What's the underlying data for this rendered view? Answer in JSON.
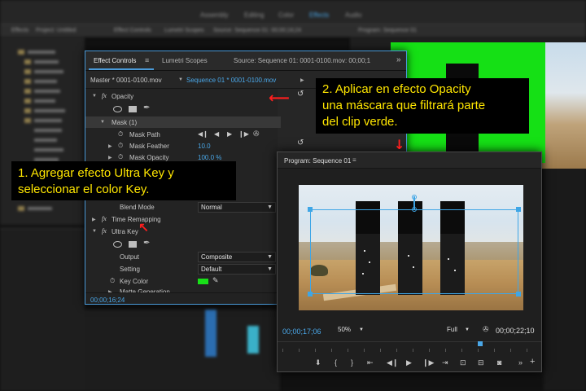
{
  "workspace_tabs": [
    "Assembly",
    "Editing",
    "Color",
    "Effects",
    "Audio"
  ],
  "workspace_active": "Effects",
  "bg_panel_tabs": [
    "Effects",
    "Project: Untitled",
    "Effect Controls",
    "Lumetri Scopes",
    "Source: Sequence 01: 00;00;16;24",
    "Program: Sequence 01"
  ],
  "effect_controls": {
    "tabs": [
      "Effect Controls",
      "Lumetri Scopes",
      "Source: Sequence 01: 0001-0100.mov: 00;00;1"
    ],
    "menu_icon": "≡",
    "overflow_icon": "»",
    "master_label": "Master * 0001-0100.mov",
    "sequence_label": "Sequence 01 * 0001-0100.mov",
    "opacity_label": "Opacity",
    "mask_label": "Mask (1)",
    "mask_path_label": "Mask Path",
    "mask_feather_label": "Mask Feather",
    "mask_feather_value": "10.0",
    "mask_opacity_label": "Mask Opacity",
    "mask_opacity_value": "100.0 %",
    "blend_mode_label": "Blend Mode",
    "blend_mode_value": "Normal",
    "time_remapping_label": "Time Remapping",
    "ultra_key_label": "Ultra Key",
    "output_label": "Output",
    "output_value": "Composite",
    "setting_label": "Setting",
    "setting_value": "Default",
    "key_color_label": "Key Color",
    "key_color": "#18e018",
    "matte_generation_label": "Matte Generation",
    "timecode": "00;00;16;24"
  },
  "program_monitor": {
    "title": "Program: Sequence 01",
    "menu_icon": "≡",
    "timecode_current": "00;00;17;06",
    "zoom": "50%",
    "quality": "Full",
    "timecode_duration": "00;00;22;10"
  },
  "callouts": {
    "callout_1": [
      "1. Agregar efecto Ultra Key y",
      "seleccionar el color Key."
    ],
    "callout_2": [
      "2. Aplicar en efecto Opacity",
      "una máscara que filtrará parte",
      "del clip verde."
    ]
  },
  "colors": {
    "accent": "#4aa7e8",
    "callout_text": "#ffe600",
    "arrow": "#ff1e1e",
    "green_screen": "#15e015"
  },
  "icons": {
    "fx": "fx",
    "reset": "↺",
    "pen": "✒",
    "wrench": "🔧",
    "stopwatch": "⏱",
    "eyedropper": "✎"
  }
}
